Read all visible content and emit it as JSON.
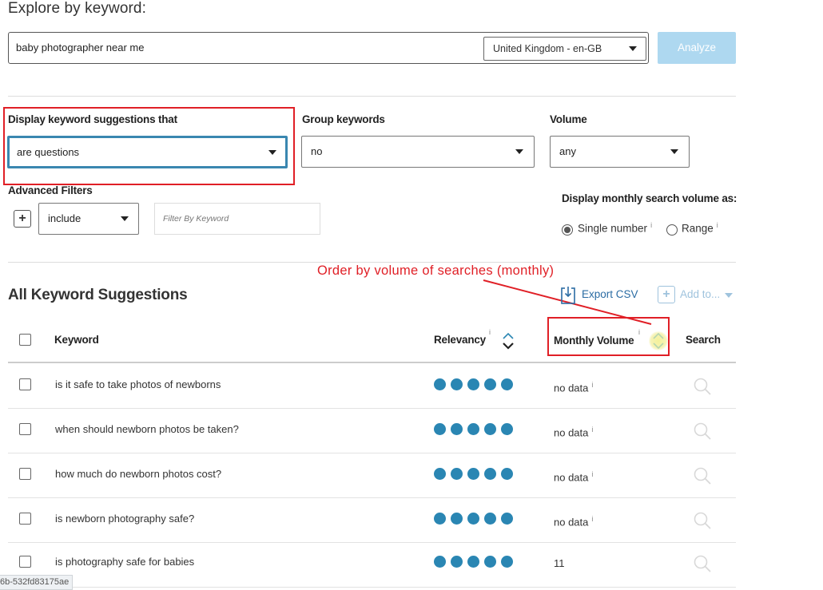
{
  "page": {
    "title": "Explore by keyword:"
  },
  "search": {
    "keyword_value": "baby photographer near me",
    "location": "United Kingdom - en-GB",
    "analyze_label": "Analyze"
  },
  "filters": {
    "display_label": "Display keyword suggestions that",
    "display_value": "are questions",
    "group_label": "Group keywords",
    "group_value": "no",
    "volume_label": "Volume",
    "volume_value": "any",
    "advanced_label": "Advanced Filters",
    "include_value": "include",
    "filter_placeholder": "Filter By Keyword",
    "monthly_label": "Display monthly search volume as:",
    "single_number_label": "Single number",
    "range_label": "Range",
    "info_glyph": "i"
  },
  "annotation": {
    "text": "Order by volume of searches (monthly)"
  },
  "suggestions": {
    "heading": "All Keyword Suggestions",
    "export_label": "Export CSV",
    "add_to_label": "Add to...",
    "columns": {
      "keyword": "Keyword",
      "relevancy": "Relevancy",
      "monthly_volume": "Monthly Volume",
      "search": "Search"
    },
    "rows": [
      {
        "keyword": "is it safe to take photos of newborns",
        "relevancy": 5,
        "volume": "no data"
      },
      {
        "keyword": "when should newborn photos be taken?",
        "relevancy": 5,
        "volume": "no data"
      },
      {
        "keyword": "how much do newborn photos cost?",
        "relevancy": 5,
        "volume": "no data"
      },
      {
        "keyword": "is newborn photography safe?",
        "relevancy": 5,
        "volume": "no data"
      },
      {
        "keyword": "is photography safe for babies",
        "relevancy": 5,
        "volume": "11"
      }
    ]
  },
  "statusbar": {
    "text": "6b-532fd83175ae"
  },
  "colors": {
    "accent": "#2a86b3",
    "annotation_red": "#e01f26",
    "analyze_bg": "#aed8f0",
    "select_highlight": "#3a87b0"
  }
}
